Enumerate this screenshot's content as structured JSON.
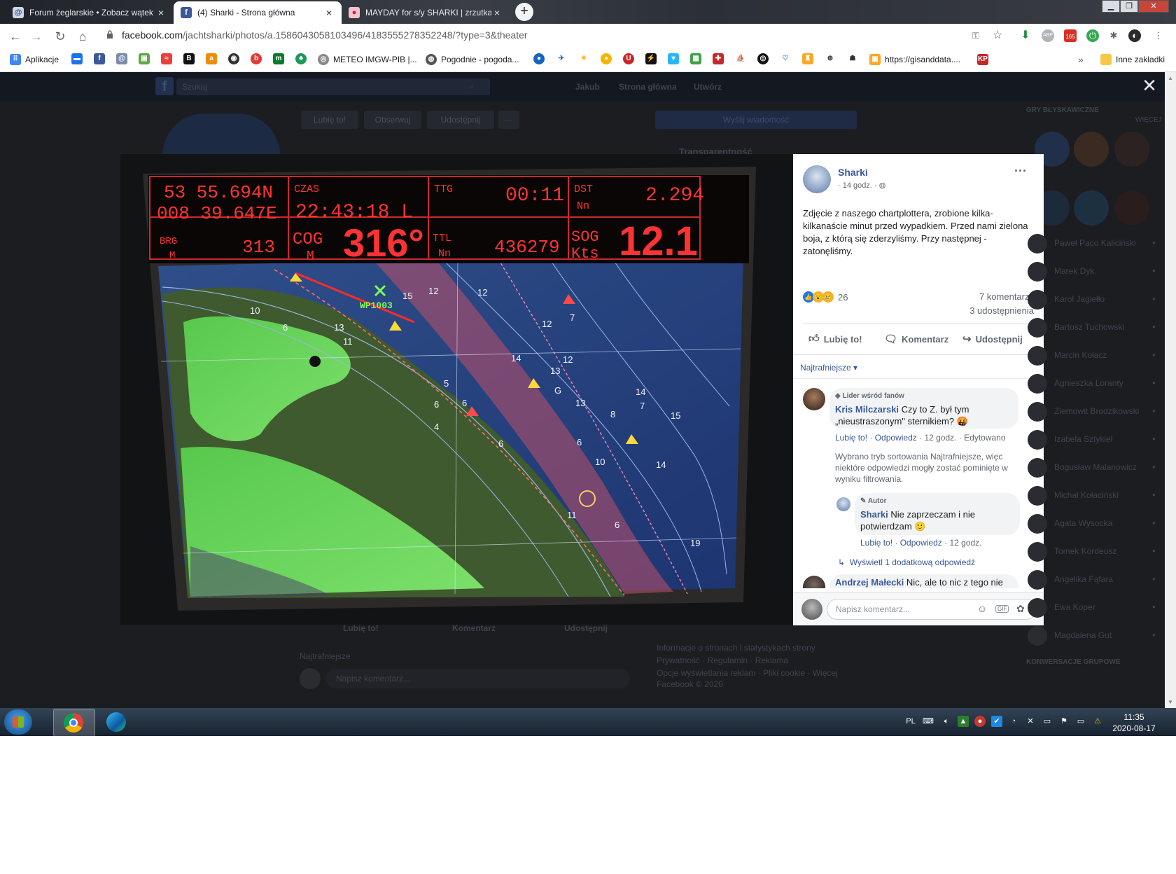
{
  "browser": {
    "tabs": [
      {
        "title": "Forum żeglarskie • Zobacz wątek",
        "close": "×",
        "icon": "site-icon"
      },
      {
        "title": "(4) Sharki - Strona główna",
        "close": "×",
        "icon": "facebook-icon"
      },
      {
        "title": "MAYDAY for s/y SHARKI | zrzutka",
        "close": "×",
        "icon": "zrzutka-icon"
      }
    ],
    "new_tab": "+",
    "url_host": "facebook.com",
    "url_path": "/jachtsharki/photos/a.1586043058103496/4183555278352248/?type=3&theater",
    "badge_count": "165",
    "bookmarks": {
      "apps": "Aplikacje",
      "meteo": "METEO IMGW-PIB |...",
      "pogodnie": "Pogodnie - pogoda...",
      "gisand": "https://gisanddata....",
      "kp": "KP",
      "more": "»",
      "other": "Inne zakładki"
    }
  },
  "facebook_bg": {
    "search_placeholder": "Szukaj",
    "user": "Jakub",
    "home": "Strona główna",
    "create": "Utwórz",
    "like_page": "Lubię to!",
    "follow": "Obserwuj",
    "share": "Udostępnij",
    "send_message": "Wyślij wiadomość",
    "transparency": "Transparentność",
    "games_header": "GRY BŁYSKAWICZNE",
    "more": "WIĘCEJ",
    "group_conv": "KONWERSACJE GRUPOWE",
    "contacts": [
      "Paweł Paco Kaliciński",
      "Marek Dyk",
      "Karol Jagiełło",
      "Bartosz Tuchowski",
      "Marcin Kołacz",
      "Agnieszka Loranty",
      "Ziemowit Brodzikowski",
      "Izabela Sztykiel",
      "Bogusław Malanowicz",
      "Michał Kołaciński",
      "Agata Wysocka",
      "Tomek Kordeusz",
      "Angelika Fąfara",
      "Ewa Koper",
      "Magdalena Gut"
    ],
    "bottom_like": "Lubię to!",
    "bottom_comment": "Komentarz",
    "bottom_share": "Udostępnij",
    "bottom_sort": "Najtrafniejsze",
    "bottom_write": "Napisz komentarz...",
    "footer_info": "Informacje o stronach i statystykach strony",
    "footer_links": "Prywatność · Regulamin · Reklama",
    "footer_cookies": "Opcje wyświetlania reklam · Pliki cookie · Więcej",
    "footer_copy": "Facebook © 2020"
  },
  "photo": {
    "chartplotter": {
      "lat": "53 55.694N",
      "lon": "008 39.647E",
      "czas_label": "CZAS",
      "time": "22:43:18 L",
      "ttg_label": "TTG",
      "ttg": "00:11",
      "dst_label": "DST",
      "dst_unit": "Nn",
      "dst": "2.294",
      "brg_label": "BRG",
      "brg_unit": "M",
      "brg": "313",
      "cog_label": "COG",
      "cog_unit": "M",
      "cog": "316°",
      "ttl_label": "TTL",
      "ttl_unit": "Nn",
      "ttl": "436279",
      "sog_label": "SOG",
      "sog_unit": "Kts",
      "sog": "12.1",
      "waypoint": "WP1003",
      "depths": [
        "12",
        "10",
        "6",
        "13",
        "11",
        "15",
        "12",
        "7",
        "12",
        "14",
        "12",
        "13",
        "6",
        "13",
        "G",
        "6",
        "14",
        "7",
        "8",
        "15",
        "10",
        "14",
        "11",
        "6",
        "19",
        "5",
        "6",
        "4",
        "6"
      ]
    }
  },
  "post": {
    "page_name": "Sharki",
    "time": "14 godz.",
    "text": "Zdjęcie z naszego chartplottera, zrobione kilka-kilkanaście minut przed wypadkiem. Przed nami zielona boja, z którą się zderzyliśmy. Przy następnej - zatonęliśmy.",
    "reactions_count": "26",
    "comments_count": "7 komentarzy",
    "shares_count": "3 udostępnienia",
    "like": "Lubię to!",
    "comment": "Komentarz",
    "share": "Udostępnij",
    "sort": "Najtrafniejsze",
    "comments": [
      {
        "badge": "Lider wśród fanów",
        "author": "Kris Milczarski",
        "text": "Czy to Z. był tym „nieustraszonym\" sternikiem? 🤬",
        "like": "Lubię to!",
        "reply": "Odpowiedz",
        "time": "12 godz.",
        "edited": "Edytowano"
      }
    ],
    "filter_note": "Wybrano tryb sortowania Najtrafniejsze, więc niektóre odpowiedzi mogły zostać pominięte w wyniku filtrowania.",
    "reply": {
      "badge": "Autor",
      "author": "Sharki",
      "text": "Nie zaprzeczam i nie potwierdzam 🙂",
      "like": "Lubię to!",
      "reply": "Odpowiedz",
      "time": "12 godz."
    },
    "more_replies": "Wyświetl 1 dodatkową odpowiedź",
    "second_comment": {
      "author": "Andrzej Małecki",
      "text": "Nic, ale to nic z tego nie"
    },
    "write_placeholder": "Napisz komentarz..."
  },
  "taskbar": {
    "lang": "PL",
    "time": "11:35",
    "date": "2020-08-17"
  }
}
